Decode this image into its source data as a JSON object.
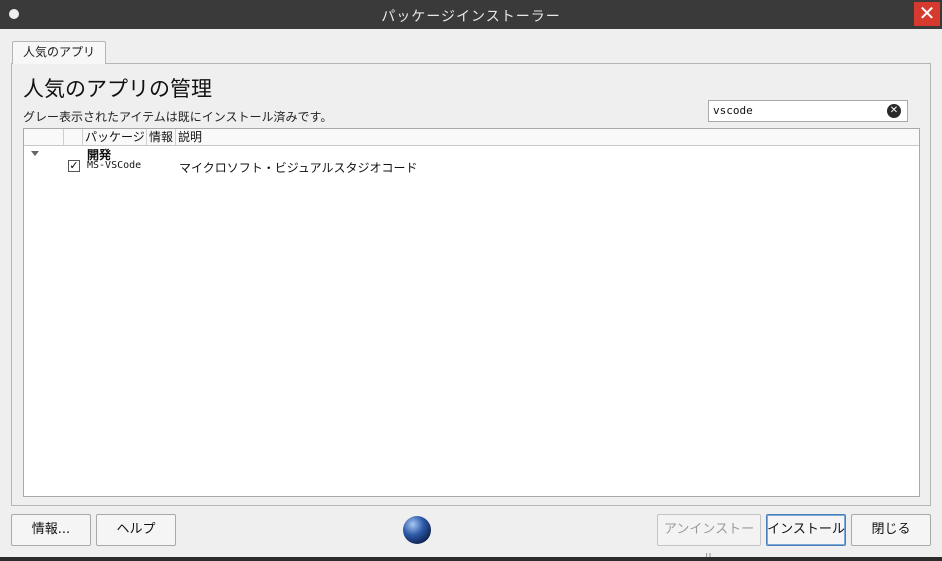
{
  "window": {
    "title": "パッケージインストーラー",
    "close_glyph": "✕"
  },
  "tab": {
    "label": "人気のアプリ"
  },
  "main": {
    "heading": "人気のアプリの管理",
    "subtitle": "グレー表示されたアイテムは既にインストール済みです。"
  },
  "search": {
    "value": "vscode",
    "clear_glyph": "✕"
  },
  "list": {
    "columns": [
      "パッケージ",
      "情報",
      "説明"
    ],
    "groups": [
      {
        "label": "開発",
        "items": [
          {
            "checked": true,
            "check_glyph": "✓",
            "package": "MS-VSCode",
            "description": "マイクロソフト・ビジュアルスタジオコード"
          }
        ]
      }
    ]
  },
  "buttons": {
    "info": "情報...",
    "help": "ヘルプ",
    "uninstall": "アンインストール",
    "install": "インストール",
    "close": "閉じる"
  },
  "icons": {
    "globe": "globe-icon"
  }
}
